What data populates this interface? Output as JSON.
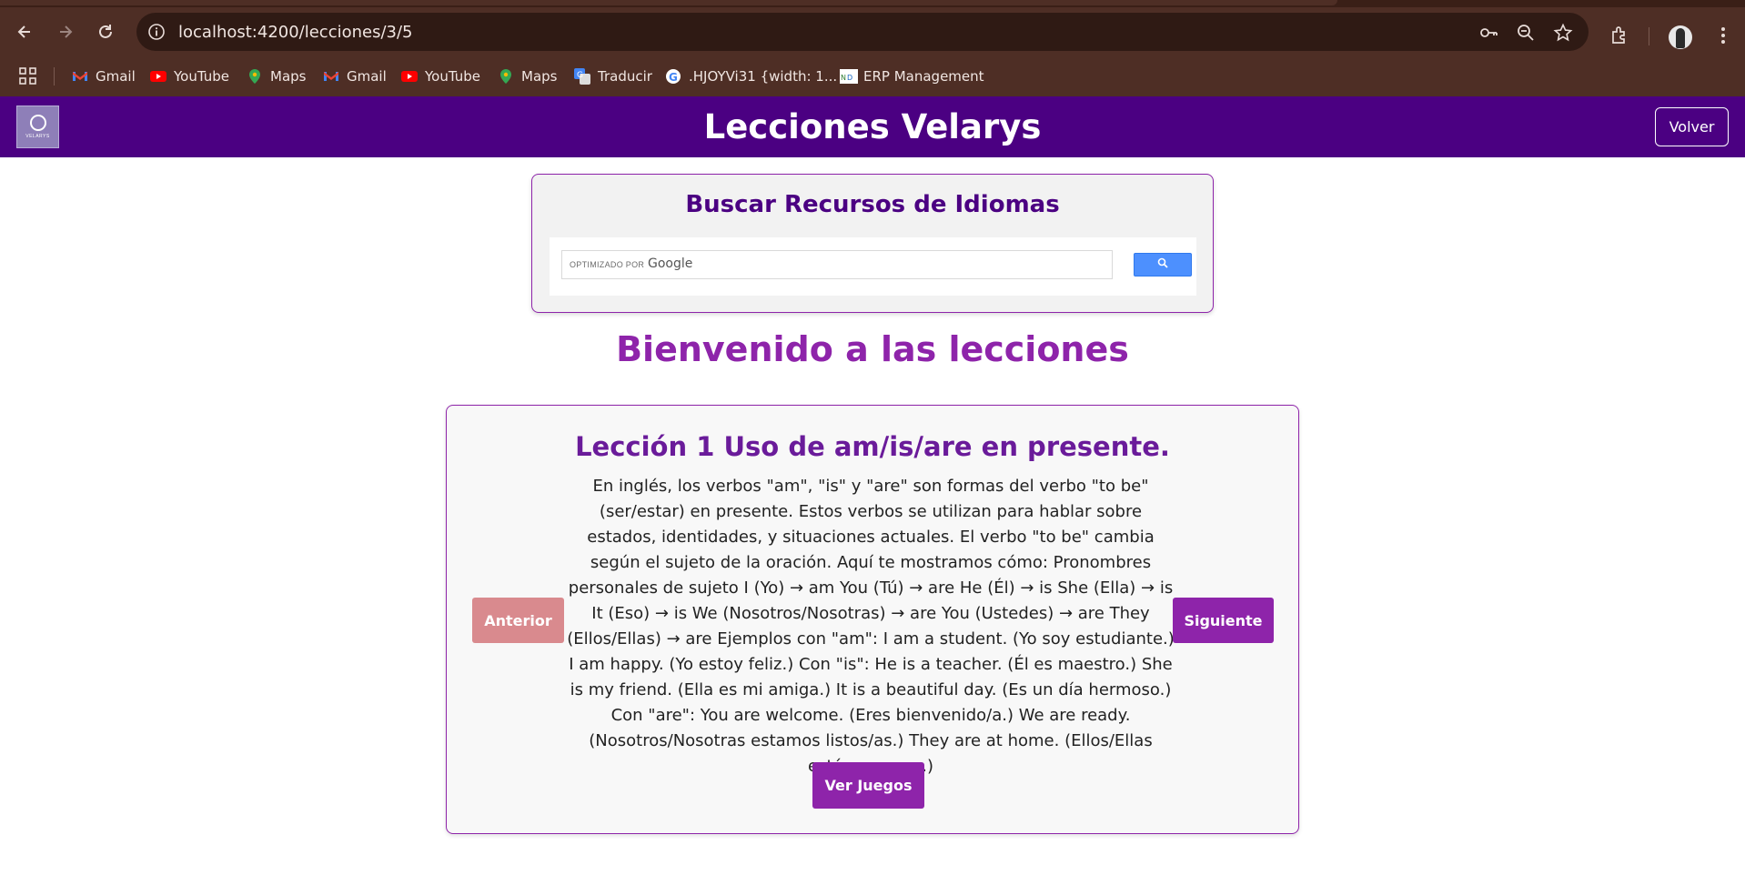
{
  "browser": {
    "url": "localhost:4200/lecciones/3/5",
    "nav_icons": [
      "back-arrow-icon",
      "forward-arrow-icon",
      "reload-icon"
    ],
    "omnibox_icons": [
      "site-info-icon",
      "password-key-icon",
      "zoom-icon",
      "bookmark-star-icon"
    ],
    "bookmarks": [
      {
        "label": "Gmail",
        "icon": "gmail-icon"
      },
      {
        "label": "YouTube",
        "icon": "youtube-icon"
      },
      {
        "label": "Maps",
        "icon": "maps-icon"
      },
      {
        "label": "Gmail",
        "icon": "gmail-icon"
      },
      {
        "label": "YouTube",
        "icon": "youtube-icon"
      },
      {
        "label": "Maps",
        "icon": "maps-icon"
      },
      {
        "label": "Traducir",
        "icon": "translate-icon"
      },
      {
        "label": ".HJOYVi31 {width: 1...",
        "icon": "google-icon"
      },
      {
        "label": "ERP Management",
        "icon": "erp-icon"
      }
    ]
  },
  "header": {
    "logo_text": "VELARYS",
    "title": "Lecciones Velarys",
    "back_label": "Volver"
  },
  "search": {
    "title": "Buscar Recursos de Idiomas",
    "powered_by": "OPTIMIZADO POR",
    "brand": "Google"
  },
  "welcome": "Bienvenido a las lecciones",
  "lesson": {
    "title": "Lección 1 Uso de am/is/are en presente.",
    "body": "En inglés, los verbos \"am\", \"is\" y \"are\" son formas del verbo \"to be\" (ser/estar) en presente. Estos verbos se utilizan para hablar sobre estados, identidades, y situaciones actuales. El verbo \"to be\" cambia según el sujeto de la oración. Aquí te mostramos cómo: Pronombres personales de sujeto I (Yo) → am You (Tú) → are He (Él) → is She (Ella) → is It (Eso) → is We (Nosotros/Nosotras) → are You (Ustedes) → are They (Ellos/Ellas) → are Ejemplos con \"am\": I am a student. (Yo soy estudiante.) I am happy. (Yo estoy feliz.) Con \"is\": He is a teacher. (Él es maestro.) She is my friend. (Ella es mi amiga.) It is a beautiful day. (Es un día hermoso.) Con \"are\": You are welcome. (Eres bienvenido/a.) We are ready. (Nosotros/Nosotras estamos listos/as.) They are at home. (Ellos/Ellas están en casa.)",
    "prev_label": "Anterior",
    "next_label": "Siguiente",
    "games_label": "Ver Juegos"
  },
  "colors": {
    "header_bg": "#4b0082",
    "accent": "#8e24aa",
    "prev_button": "#d98a8e",
    "browser_chrome": "#4e2e25"
  }
}
